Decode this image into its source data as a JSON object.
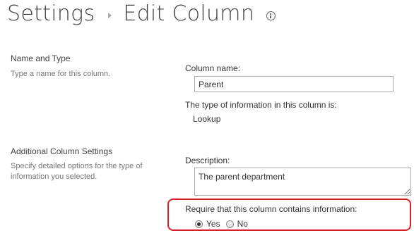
{
  "header": {
    "crumb_settings": "Settings",
    "crumb_current": "Edit Column",
    "separator_icon": "chevron-right-icon",
    "help_icon": "info-icon"
  },
  "sections": {
    "name_type": {
      "title": "Name and Type",
      "description": "Type a name for this column."
    },
    "additional": {
      "title": "Additional Column Settings",
      "description_line1": "Specify detailed options for the type of",
      "description_line2": "information you selected."
    }
  },
  "fields": {
    "column_name": {
      "label": "Column name:",
      "value": "Parent"
    },
    "type_info": {
      "label": "The type of information in this column is:",
      "value": "Lookup"
    },
    "description": {
      "label": "Description:",
      "value": "The parent department"
    },
    "require": {
      "label": "Require that this column contains information:",
      "options": [
        {
          "label": "Yes",
          "selected": true
        },
        {
          "label": "No",
          "selected": false
        }
      ]
    }
  },
  "colors": {
    "highlight": "#d81e26",
    "text": "#444444",
    "muted": "#777777"
  }
}
